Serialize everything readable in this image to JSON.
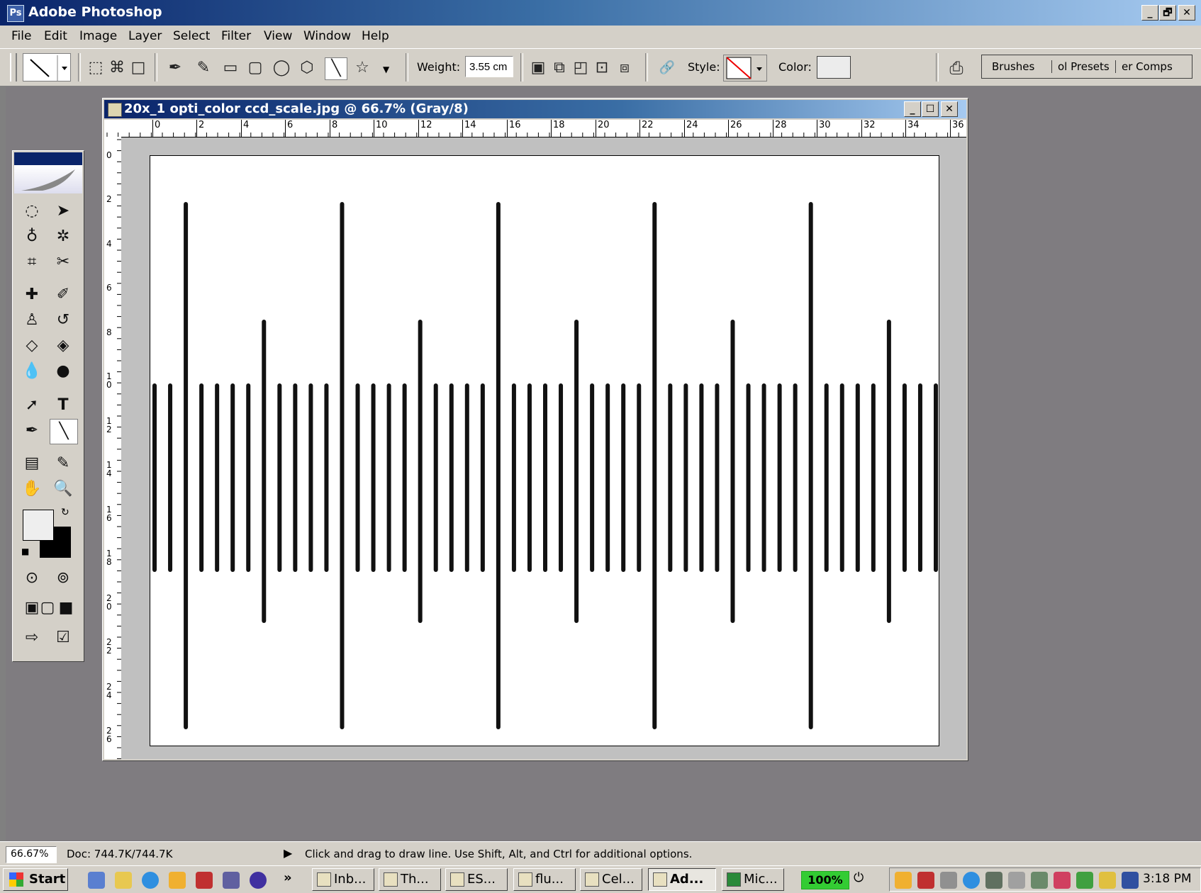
{
  "app": {
    "title": "Adobe Photoshop"
  },
  "window_controls": {
    "minimize": "_",
    "restore": "🗗",
    "close": "✕"
  },
  "menu": [
    "File",
    "Edit",
    "Image",
    "Layer",
    "Select",
    "Filter",
    "View",
    "Window",
    "Help"
  ],
  "options_bar": {
    "weight_label": "Weight:",
    "weight_value": "3.55 cm",
    "style_label": "Style:",
    "color_label": "Color:",
    "palette_tabs": [
      "Brushes",
      "ol Presets",
      "er Comps"
    ]
  },
  "document": {
    "title": "20x_1 opti_color ccd_scale.jpg @ 66.7% (Gray/8)",
    "h_ruler": [
      "0",
      "2",
      "4",
      "6",
      "8",
      "10",
      "12",
      "14",
      "16",
      "18",
      "20",
      "22",
      "24",
      "26",
      "28",
      "30",
      "32",
      "34",
      "36"
    ],
    "v_ruler": [
      "0",
      "2",
      "4",
      "6",
      "8",
      "10",
      "12",
      "14",
      "16",
      "18",
      "20",
      "22",
      "24",
      "26"
    ]
  },
  "status": {
    "zoom": "66.67%",
    "doc": "Doc: 744.7K/744.7K",
    "hint": "Click and drag to draw line.  Use Shift, Alt, and Ctrl for additional options."
  },
  "taskbar": {
    "start": "Start",
    "chevron": "»",
    "tasks": [
      "Inb...",
      "Th...",
      "ES...",
      "flu...",
      "Cel...",
      "Ad...",
      "Mic..."
    ],
    "battery": "100%",
    "clock": "3:18 PM"
  },
  "colors": {
    "title_bar": "#0a246a",
    "chrome": "#d4d0c8",
    "workspace": "#7f7c80",
    "battery_bg": "#33cc33"
  }
}
